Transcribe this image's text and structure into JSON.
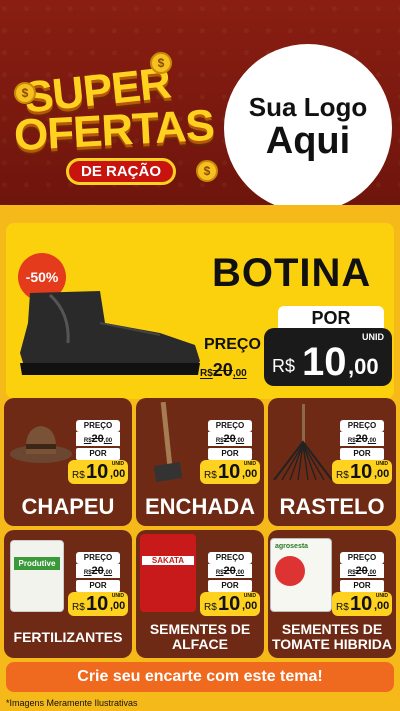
{
  "header": {
    "super": "SUPER",
    "ofertas": "OFERTAS",
    "racao": "DE RAÇÃO",
    "logo_line1": "Sua Logo",
    "logo_line2": "Aqui",
    "coin_symbol": "$"
  },
  "hero": {
    "discount": "-50%",
    "title": "BOTINA",
    "preco_label": "PREÇO",
    "old_currency": "R$",
    "old_int": "20",
    "old_dec": ",00",
    "por_label": "POR",
    "new_currency": "R$",
    "new_int": "10",
    "new_dec": ",00",
    "unit": "UNID"
  },
  "price_tag": {
    "preco": "PREÇO",
    "old_currency": "R$",
    "old_int": "20",
    "old_dec": ",00",
    "por": "POR",
    "currency": "R$",
    "int": "10",
    "dec": ",00",
    "unit": "UNID"
  },
  "products": [
    {
      "name": "CHAPEU"
    },
    {
      "name": "ENCHADA"
    },
    {
      "name": "RASTELO"
    },
    {
      "name": "FERTILIZANTES",
      "pkg_brand": "Produtive"
    },
    {
      "name": "SEMENTES DE ALFACE",
      "pkg_brand": "SAKATA"
    },
    {
      "name": "SEMENTES DE TOMATE HIBRIDA",
      "pkg_brand": "agrosesta"
    }
  ],
  "cta": "Crie seu encarte com este tema!",
  "disclaimer": "*Imagens Meramente Ilustrativas",
  "colors": {
    "header": "#7a1a10",
    "background": "#f6b91a",
    "card": "#6e2a14",
    "accent": "#ffd21f",
    "cta": "#ef6a1e"
  }
}
